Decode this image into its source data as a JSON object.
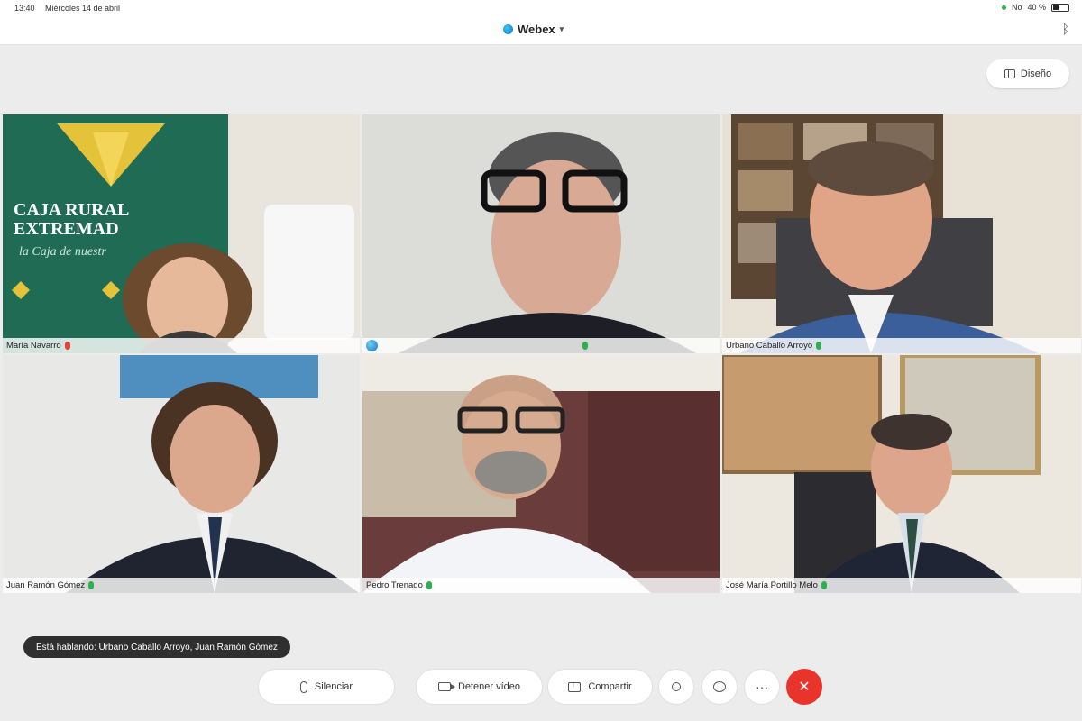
{
  "status_bar": {
    "time": "13:40",
    "date": "Miércoles 14 de abril",
    "signal": "No",
    "battery_text": "40 %",
    "battery_level": 0.4
  },
  "title_bar": {
    "app_name": "Webex",
    "bluetooth_icon": "bluetooth-icon"
  },
  "layout_button": {
    "label": "Diseño",
    "icon": "layout-icon"
  },
  "participants": [
    {
      "name": "María Navarro",
      "mic": "muted",
      "active": false
    },
    {
      "name": "",
      "mic": "on",
      "active": false,
      "icon": "webex-avatar-icon"
    },
    {
      "name": "Urbano Caballo Arroyo",
      "mic": "on",
      "active": true
    },
    {
      "name": "Juan Ramón Gómez",
      "mic": "on",
      "active": false
    },
    {
      "name": "Pedro Trenado",
      "mic": "on",
      "active": false
    },
    {
      "name": "José María Portillo Melo",
      "mic": "on",
      "active": false
    }
  ],
  "background_text": {
    "brand_line1": "CAJA RURAL",
    "brand_line2": "EXTREMAD",
    "tagline": "la Caja de nuestr"
  },
  "speaking_banner": "Está hablando: Urbano Caballo Arroyo, Juan Ramón Gómez",
  "controls": {
    "mute_label": "Silenciar",
    "video_label": "Detener vídeo",
    "share_label": "Compartir",
    "participants_icon": "person-icon",
    "chat_icon": "chat-icon",
    "more_icon": "more-icon",
    "end_icon": "close-icon",
    "accent_end": "#e8342b"
  }
}
